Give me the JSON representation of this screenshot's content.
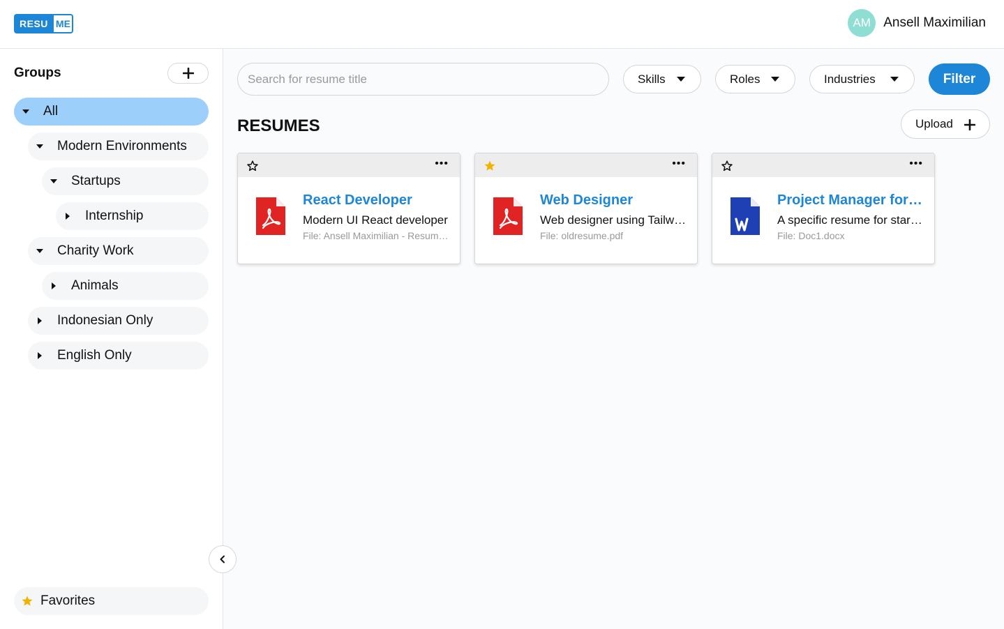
{
  "header": {
    "logo_left": "RESU",
    "logo_right": "ME",
    "user": {
      "initials": "AM",
      "name": "Ansell Maximilian",
      "avatar_color": "#8fded4"
    }
  },
  "sidebar": {
    "title": "Groups",
    "add_icon": "plus-icon",
    "tree": [
      {
        "label": "All",
        "expanded": true,
        "active": true,
        "level": 0
      },
      {
        "label": "Modern Environments",
        "expanded": true,
        "level": 1
      },
      {
        "label": "Startups",
        "expanded": true,
        "level": 2
      },
      {
        "label": "Internship",
        "expanded": false,
        "level": 3
      },
      {
        "label": "Charity Work",
        "expanded": true,
        "level": 1
      },
      {
        "label": "Animals",
        "expanded": false,
        "level": 2
      },
      {
        "label": "Indonesian Only",
        "expanded": false,
        "level": 1
      },
      {
        "label": "English Only",
        "expanded": false,
        "level": 1
      }
    ],
    "favorites_label": "Favorites",
    "collapse_icon": "chevron-left-icon"
  },
  "toolbar": {
    "search_placeholder": "Search for resume title",
    "skills_label": "Skills",
    "roles_label": "Roles",
    "industries_label": "Industries",
    "filter_label": "Filter"
  },
  "resumes": {
    "section_title": "RESUMES",
    "upload_label": "Upload",
    "cards": [
      {
        "title": "React Developer",
        "description": "Modern UI React developer",
        "file": "File: Ansell Maximilian - Resume.pdf",
        "type": "pdf",
        "favorite": false
      },
      {
        "title": "Web Designer",
        "description": "Web designer using Tailwind",
        "file": "File: oldresume.pdf",
        "type": "pdf",
        "favorite": true
      },
      {
        "title": "Project Manager for Startups",
        "description": "A specific resume for startups",
        "file": "File: Doc1.docx",
        "type": "docx",
        "favorite": false
      }
    ]
  },
  "colors": {
    "accent": "#1e86d6",
    "active_group": "#9ccffa",
    "pdf_red": "#e02424",
    "word_blue": "#1f3fb5",
    "star_gold": "#f0b400"
  }
}
